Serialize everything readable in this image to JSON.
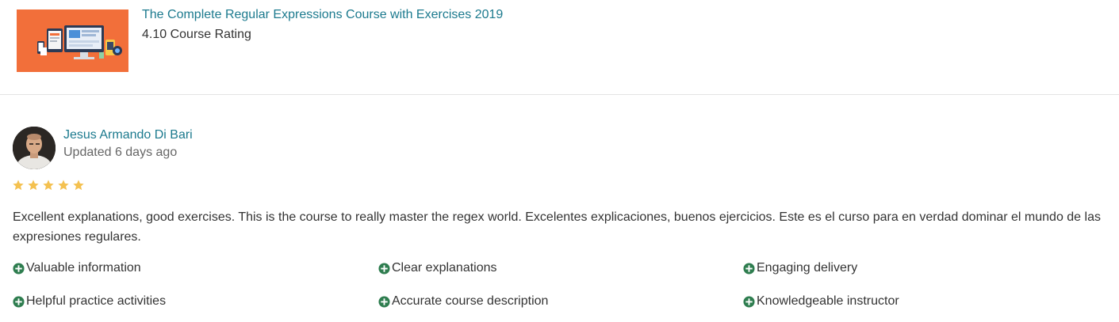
{
  "course": {
    "title": "The Complete Regular Expressions Course with Exercises 2019",
    "rating_text": "4.10 Course Rating",
    "thumbnail_color": "#f26f3a"
  },
  "review": {
    "reviewer_name": "Jesus Armando Di Bari",
    "updated": "Updated 6 days ago",
    "stars": 5,
    "star_color": "#f4c150",
    "text": "Excellent explanations, good exercises. This is the course to really master the regex world. Excelentes explicaciones, buenos ejercicios. Este es el curso para en verdad dominar el mundo de las expresiones regulares.",
    "tags": [
      "Valuable information",
      "Clear explanations",
      "Engaging delivery",
      "Helpful practice activities",
      "Accurate course description",
      "Knowledgeable instructor"
    ],
    "tag_icon": "plus-circle-icon",
    "tag_icon_color": "#2e7d4f"
  },
  "colors": {
    "link": "#1c7a8e",
    "text": "#333333",
    "muted": "#666666",
    "divider": "#e4e4e4"
  }
}
